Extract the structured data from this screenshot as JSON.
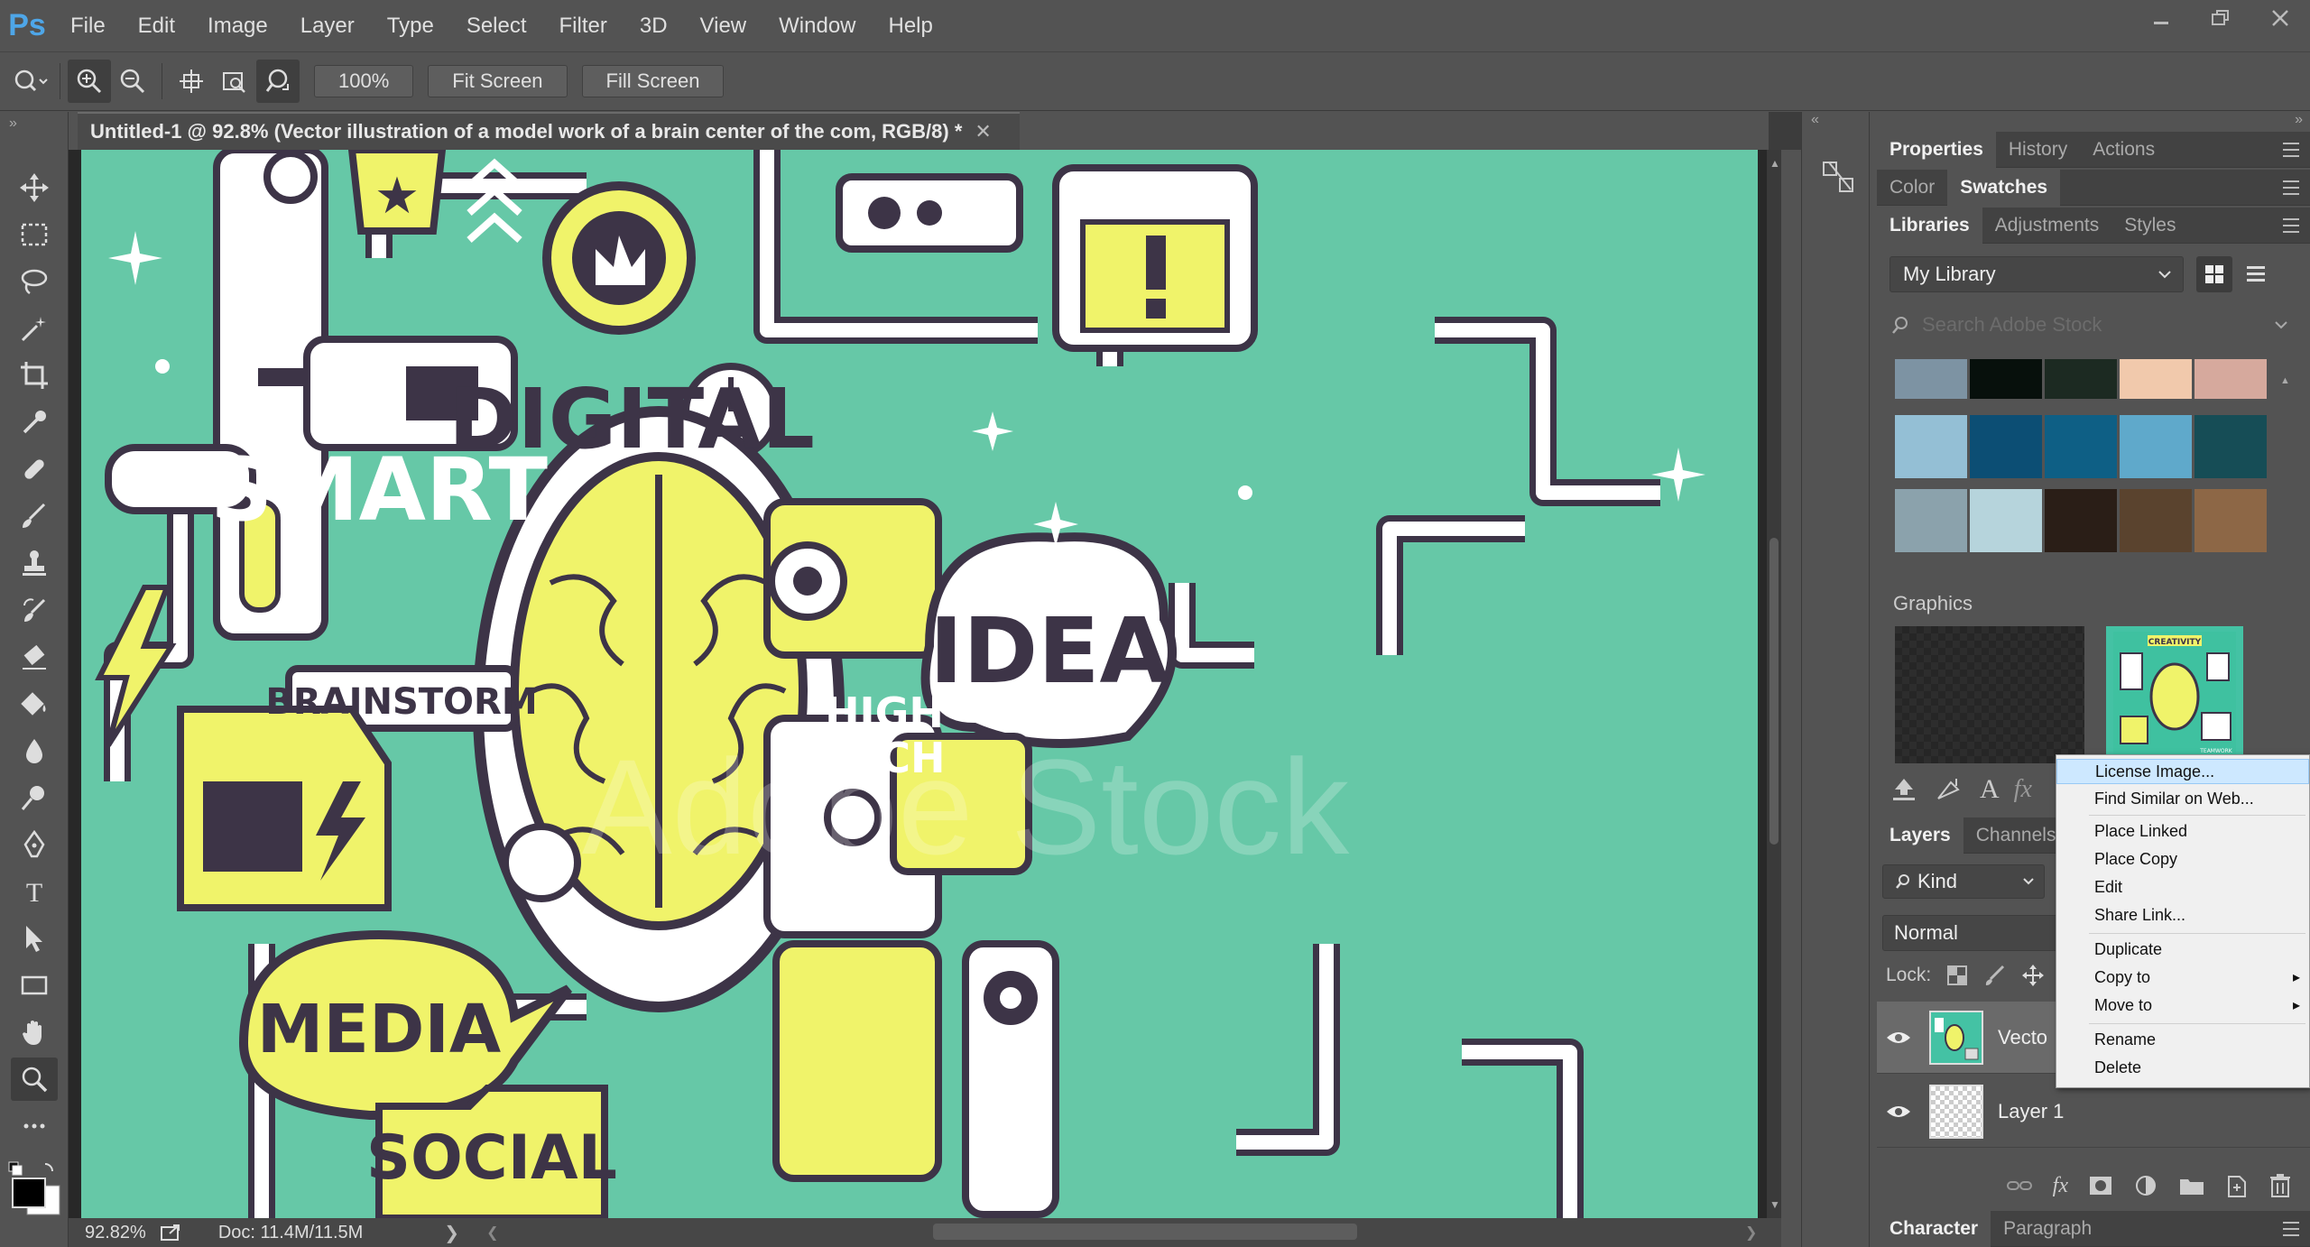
{
  "app": {
    "logo": "Ps"
  },
  "menu": [
    "File",
    "Edit",
    "Image",
    "Layer",
    "Type",
    "Select",
    "Filter",
    "3D",
    "View",
    "Window",
    "Help"
  ],
  "options": {
    "zoom_value": "100%",
    "fit_screen": "Fit Screen",
    "fill_screen": "Fill Screen"
  },
  "document": {
    "tab_title": "Untitled-1 @ 92.8% (Vector illustration of a model work of a brain center of the com, RGB/8) *",
    "watermark": "Adobe Stock",
    "art_labels": {
      "digital": "DIGITAL",
      "smart": "SMART",
      "brainstorm": "BRAINSTORM",
      "high": "HIGH",
      "tech": "TECH",
      "idea": "IDEA",
      "media": "MEDIA",
      "social": "SOCIAL"
    }
  },
  "status": {
    "zoom": "92.82%",
    "doc": "Doc: 11.4M/11.5M"
  },
  "panels": {
    "row1_tabs": [
      "Properties",
      "History",
      "Actions"
    ],
    "row2_tabs": [
      "Color",
      "Swatches"
    ],
    "row3_tabs": [
      "Libraries",
      "Adjustments",
      "Styles"
    ],
    "library_name": "My Library",
    "search_placeholder": "Search Adobe Stock",
    "graphics_label": "Graphics",
    "swatch_colors": [
      [
        "#7d93a3",
        "#07100c",
        "#1c2a22",
        "#f1c9ac",
        "#d6a99d"
      ],
      [
        "#94bfd5",
        "#0c4e74",
        "#0e5f85",
        "#5fa9cb",
        "#164d56"
      ],
      [
        "#8ba2ac",
        "#b6d4dc",
        "#2a1e17",
        "#5a432e",
        "#8d6746"
      ]
    ],
    "thumb_caption": "CREATIVITY",
    "thumb_caption2": "TEAMWORK"
  },
  "layers": {
    "tabs": [
      "Layers",
      "Channels"
    ],
    "kind": "Kind",
    "blend": "Normal",
    "lock_label": "Lock:",
    "items": [
      {
        "name": "Vecto",
        "selected": true
      },
      {
        "name": "Layer 1",
        "selected": false
      }
    ]
  },
  "context_menu": {
    "items": [
      "License Image...",
      "Find Similar on Web...",
      "Place Linked",
      "Place Copy",
      "Edit",
      "Share Link...",
      "Duplicate",
      "Copy to",
      "Move to",
      "Rename",
      "Delete"
    ]
  },
  "bottom_tabs": [
    "Character",
    "Paragraph"
  ]
}
